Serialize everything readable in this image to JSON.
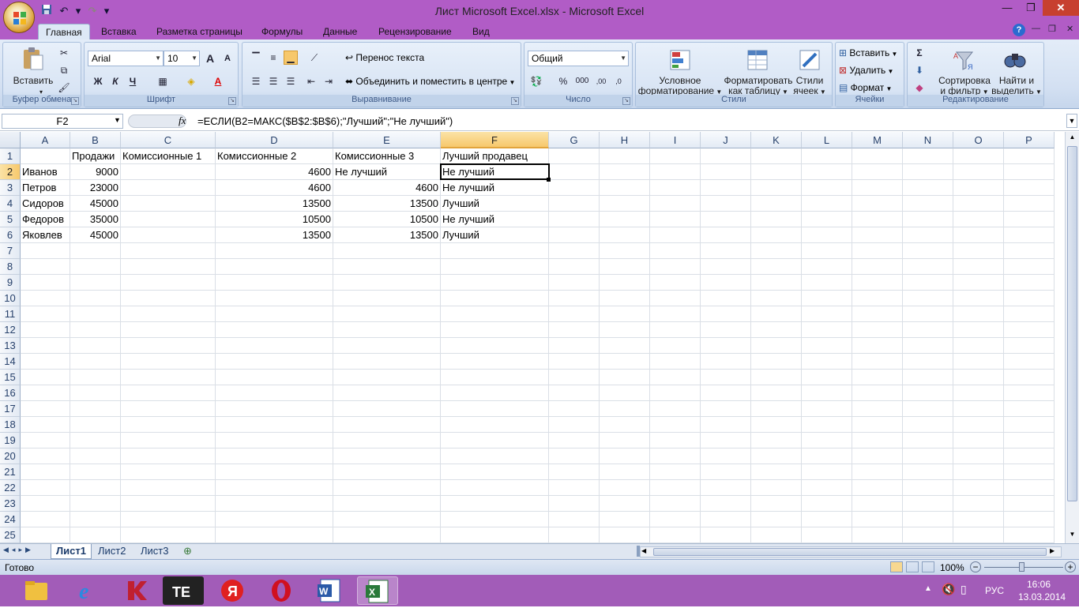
{
  "window": {
    "title": "Лист Microsoft Excel.xlsx - Microsoft Excel",
    "minimize": "—",
    "restore": "❐",
    "close": "✕"
  },
  "qat": {
    "save": "save-icon",
    "undo": "↶",
    "redo": "↷",
    "more": "▾"
  },
  "tabs": [
    "Главная",
    "Вставка",
    "Разметка страницы",
    "Формулы",
    "Данные",
    "Рецензирование",
    "Вид"
  ],
  "ribbon": {
    "clipboard": {
      "label": "Буфер обмена",
      "paste": "Вставить"
    },
    "font": {
      "label": "Шрифт",
      "name": "Arial",
      "size": "10",
      "bold": "Ж",
      "italic": "К",
      "underline": "Ч",
      "grow": "A",
      "shrink": "A"
    },
    "alignment": {
      "label": "Выравнивание",
      "wrap": "Перенос текста",
      "merge": "Объединить и поместить в центре"
    },
    "number": {
      "label": "Число",
      "format": "Общий",
      "percent": "%",
      "thousands": "000"
    },
    "styles": {
      "label": "Стили",
      "conditional": "Условное\nформатирование",
      "conditional1": "Условное",
      "conditional2": "форматирование",
      "table1": "Форматировать",
      "table2": "как таблицу",
      "cell1": "Стили",
      "cell2": "ячеек"
    },
    "cells": {
      "label": "Ячейки",
      "insert": "Вставить",
      "delete": "Удалить",
      "format": "Формат"
    },
    "editing": {
      "label": "Редактирование",
      "sort1": "Сортировка",
      "sort2": "и фильтр",
      "find1": "Найти и",
      "find2": "выделить"
    }
  },
  "formula_bar": {
    "name": "F2",
    "fx": "fx",
    "formula": "=ЕСЛИ(B2=МАКС($B$2:$B$6);\"Лучший\";\"Не лучший\")"
  },
  "columns": [
    "A",
    "B",
    "C",
    "D",
    "E",
    "F",
    "G",
    "H",
    "I",
    "J",
    "K",
    "L",
    "M",
    "N",
    "O",
    "P"
  ],
  "rows": [
    "1",
    "2",
    "3",
    "4",
    "5",
    "6",
    "7",
    "8",
    "9",
    "10",
    "11",
    "12",
    "13",
    "14",
    "15",
    "16",
    "17",
    "18",
    "19",
    "20",
    "21",
    "22",
    "23",
    "24",
    "25"
  ],
  "cells": {
    "B1": "Продажи",
    "C1": "Комиссионные 1",
    "D1": "Комиссионные 2",
    "E1": "Комиссионные 3",
    "F1": "Лучший продавец",
    "A2": "Иванов",
    "B2": "9000",
    "D2": "4600",
    "E2": "Не лучший",
    "F2": "Не лучший",
    "A3": "Петров",
    "B3": "23000",
    "D3": "4600",
    "E3": "4600",
    "F3": "Не лучший",
    "A4": "Сидоров",
    "B4": "45000",
    "D4": "13500",
    "E4": "13500",
    "F4": "Лучший",
    "A5": "Федоров",
    "B5": "35000",
    "D5": "10500",
    "E5": "10500",
    "F5": "Не лучший",
    "A6": "Яковлев",
    "B6": "45000",
    "D6": "13500",
    "E6": "13500",
    "F6": "Лучший"
  },
  "sheets": [
    "Лист1",
    "Лист2",
    "Лист3"
  ],
  "status": {
    "ready": "Готово",
    "zoom": "100%"
  },
  "taskbar": {
    "lang": "РУС",
    "time": "16:06",
    "date": "13.03.2014"
  }
}
